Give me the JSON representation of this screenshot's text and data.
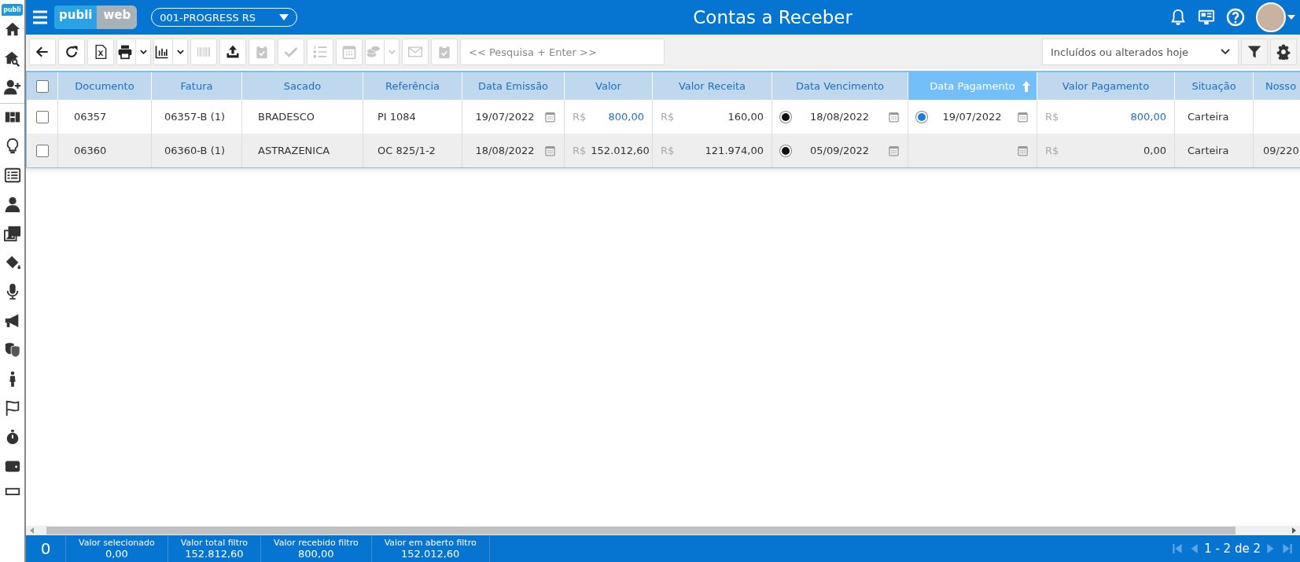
{
  "sidebar": {
    "logo": "publi",
    "items": [
      {
        "selected": false
      },
      {
        "selected": false
      },
      {
        "selected": false
      },
      {
        "selected": false
      },
      {
        "selected": false
      },
      {
        "selected": false
      },
      {
        "selected": false
      },
      {
        "selected": false
      },
      {
        "selected": false
      },
      {
        "selected": false
      },
      {
        "selected": false
      },
      {
        "selected": false
      },
      {
        "selected": false
      },
      {
        "selected": false
      },
      {
        "selected": false
      },
      {
        "selected": false
      },
      {
        "selected": false
      }
    ]
  },
  "header": {
    "logo_left": "publi",
    "logo_right": "web",
    "company": "001-PROGRESS RS",
    "title": "Contas a Receber"
  },
  "toolbar": {
    "buttons": [
      {
        "disabled": false,
        "menu": false
      },
      {
        "disabled": false,
        "menu": false
      },
      {
        "disabled": false,
        "menu": false
      },
      {
        "disabled": false,
        "menu": true
      },
      {
        "disabled": false,
        "menu": true
      },
      {
        "disabled": true,
        "menu": false
      },
      {
        "disabled": false,
        "menu": false
      },
      {
        "disabled": true,
        "menu": false
      },
      {
        "disabled": true,
        "menu": false
      },
      {
        "disabled": true,
        "menu": false
      },
      {
        "disabled": true,
        "menu": false
      },
      {
        "disabled": true,
        "menu": true
      },
      {
        "disabled": true,
        "menu": false
      },
      {
        "disabled": true,
        "menu": false
      }
    ],
    "search": {
      "placeholder": "<< Pesquisa + Enter >>"
    },
    "filter": {
      "value": "Incluídos ou alterados hoje"
    }
  },
  "table": {
    "select_all": {
      "checked": false
    },
    "columns": [
      {
        "label": "Documento",
        "sorted": false
      },
      {
        "label": "Fatura",
        "sorted": false
      },
      {
        "label": "Sacado",
        "sorted": false
      },
      {
        "label": "Referência",
        "sorted": false
      },
      {
        "label": "Data Emissão",
        "sorted": false
      },
      {
        "label": "Valor",
        "sorted": false
      },
      {
        "label": "Valor Receita",
        "sorted": false
      },
      {
        "label": "Data Vencimento",
        "sorted": false
      },
      {
        "label": "Data Pagamento",
        "sorted": true
      },
      {
        "label": "Valor Pagamento",
        "sorted": false
      },
      {
        "label": "Situação",
        "sorted": false
      },
      {
        "label": "Nosso",
        "sorted": false
      }
    ],
    "rows": [
      {
        "selected": false,
        "documento": "06357",
        "fatura": "06357-B (1)",
        "sacado": "BRADESCO",
        "referencia": "PI 1084",
        "data_emissao": "19/07/2022",
        "valor": {
          "currency": "R$",
          "amount": "800,00",
          "highlight": true
        },
        "valor_receita": {
          "currency": "R$",
          "amount": "160,00",
          "highlight": false
        },
        "data_vencimento": {
          "date": "18/08/2022",
          "color": "#111111"
        },
        "data_pagamento": {
          "date": "19/07/2022",
          "color": "#1a7fd6"
        },
        "valor_pagamento": {
          "currency": "R$",
          "amount": "800,00",
          "highlight": true
        },
        "situacao": "Carteira"
      },
      {
        "selected": false,
        "documento": "06360",
        "fatura": "06360-B (1)",
        "sacado": "ASTRAZENICA",
        "referencia": "OC 825/1-2",
        "data_emissao": "18/08/2022",
        "valor": {
          "currency": "R$",
          "amount": "152.012,60",
          "highlight": false
        },
        "valor_receita": {
          "currency": "R$",
          "amount": "121.974,00",
          "highlight": false
        },
        "data_vencimento": {
          "date": "05/09/2022",
          "color": "#111111"
        },
        "data_pagamento": {},
        "valor_pagamento": {
          "currency": "R$",
          "amount": "0,00",
          "highlight": false
        },
        "situacao": "Carteira",
        "nosso": "09/220"
      }
    ]
  },
  "status_bar": {
    "selected_count": "0",
    "totals": [
      {
        "label": "Valor selecionado",
        "value": "0,00"
      },
      {
        "label": "Valor total filtro",
        "value": "152.812,60"
      },
      {
        "label": "Valor recebido filtro",
        "value": "800,00"
      },
      {
        "label": "Valor em aberto filtro",
        "value": "152.012,60"
      }
    ],
    "pagination": "1 - 2 de 2"
  }
}
